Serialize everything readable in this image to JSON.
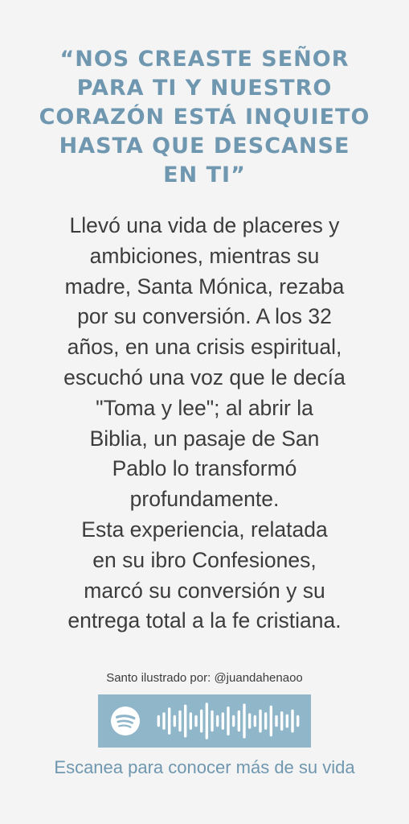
{
  "quote": {
    "lines": [
      "“Nos creaste Señor",
      "para ti y nuestro",
      "corazón está inquieto",
      "hasta que descanse",
      "en ti”"
    ]
  },
  "body": {
    "lines": [
      "Llevó una vida de placeres y",
      "ambiciones, mientras su",
      "madre, Santa Mónica, rezaba",
      "por su conversión. A los 32",
      "años, en una crisis espiritual,",
      "escuchó una voz que le decía",
      "\"Toma y lee\"; al abrir la",
      "Biblia, un pasaje de San",
      "Pablo lo transformó",
      "profundamente.",
      "Esta experiencia, relatada",
      "en su ibro Confesiones,",
      "marcó su conversión y su",
      "entrega total a la fe cristiana."
    ]
  },
  "credit": "Santo ilustrado por: @juandahenaoo",
  "spotify_code": {
    "icon": "spotify-icon",
    "bar_levels": [
      0.3,
      0.45,
      0.7,
      0.3,
      0.55,
      0.85,
      0.45,
      0.3,
      0.6,
      0.95,
      0.55,
      0.3,
      0.45,
      0.75,
      0.3,
      0.55,
      0.9,
      0.4,
      0.3,
      0.6,
      0.45,
      0.8,
      0.3,
      0.5,
      0.35,
      0.6,
      0.3
    ],
    "background": "#8fb6c9",
    "foreground": "#ffffff"
  },
  "scan_text": "Escanea para conocer más de su vida",
  "colors": {
    "accent": "#6f97b0",
    "text": "#3c3c3c",
    "background": "#f4f4f4"
  }
}
